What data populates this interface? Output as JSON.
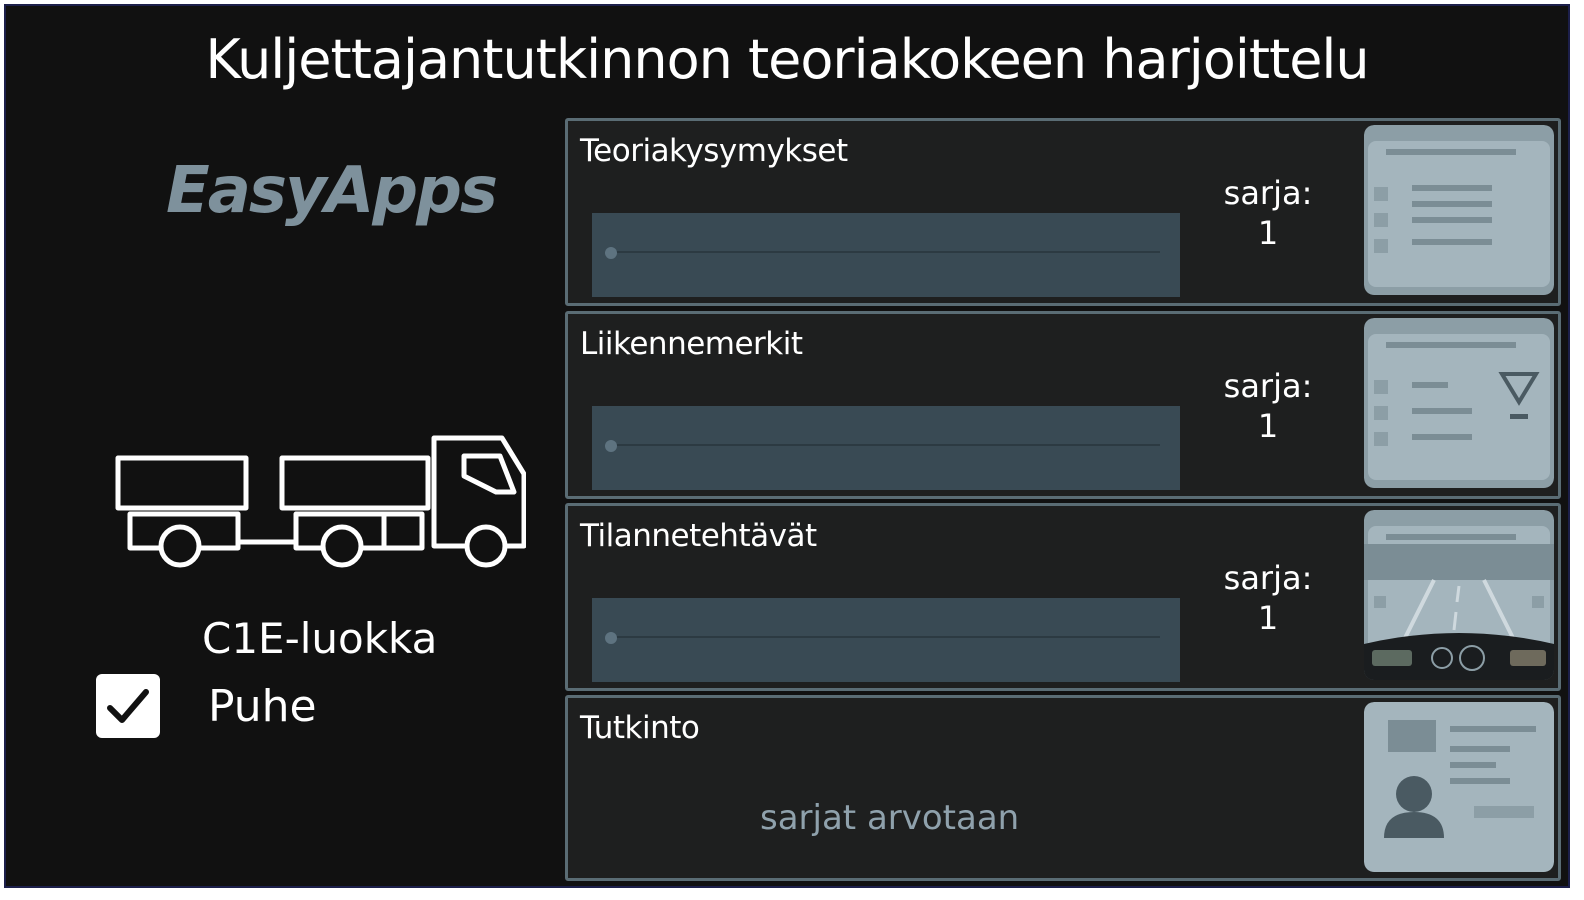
{
  "header": {
    "title": "Kuljettajantutkinnon teoriakokeen harjoittelu"
  },
  "sidebar": {
    "brand": "EasyApps",
    "license_class": "C1E-luokka",
    "speech_label": "Puhe",
    "speech_checked": true
  },
  "modules": [
    {
      "title": "Teoriakysymykset",
      "series_label": "sarja:",
      "series_value": "1",
      "progress": 0,
      "icon": "question-card-icon"
    },
    {
      "title": "Liikennemerkit",
      "series_label": "sarja:",
      "series_value": "1",
      "progress": 0,
      "icon": "traffic-sign-card-icon"
    },
    {
      "title": "Tilannetehtävät",
      "series_label": "sarja:",
      "series_value": "1",
      "progress": 0,
      "icon": "driving-view-icon"
    },
    {
      "title": "Tutkinto",
      "subtitle": "sarjat arvotaan",
      "icon": "id-card-icon"
    }
  ],
  "colors": {
    "background": "#111111",
    "panel": "#1e1f1f",
    "panel_border": "#5a6c74",
    "progress_bg": "#394a54",
    "logo": "#7e919c",
    "card": "#a4b5bd"
  }
}
